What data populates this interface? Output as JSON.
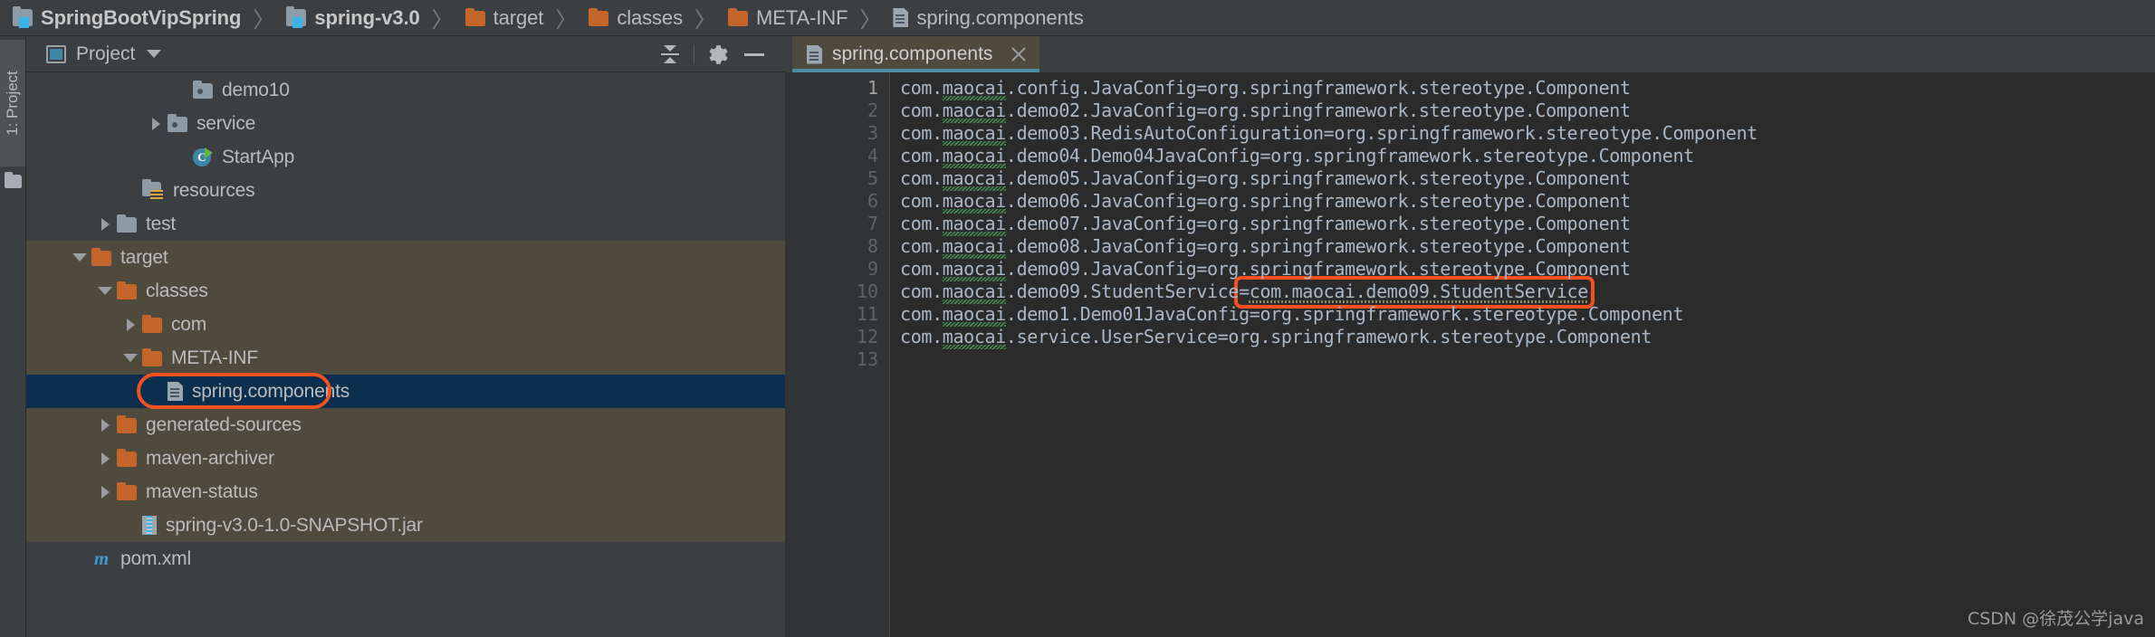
{
  "breadcrumb": {
    "items": [
      {
        "label": "SpringBootVipSpring",
        "icon": "module-icon",
        "bold": true
      },
      {
        "label": "spring-v3.0",
        "icon": "module-icon",
        "bold": true
      },
      {
        "label": "target",
        "icon": "folder-orange-icon",
        "bold": false
      },
      {
        "label": "classes",
        "icon": "folder-orange-icon",
        "bold": false
      },
      {
        "label": "META-INF",
        "icon": "folder-orange-icon",
        "bold": false
      },
      {
        "label": "spring.components",
        "icon": "file-icon",
        "bold": false
      }
    ],
    "separator": "〉"
  },
  "tool_strip": {
    "project_button_label": "1: Project",
    "folder_icon": "folder-icon"
  },
  "project_panel": {
    "title": "Project",
    "window_icon": "project-window-icon",
    "dropdown_icon": "chevron-down-icon",
    "toolbar": [
      {
        "name": "collapse-all-icon",
        "label": "Collapse All"
      },
      {
        "name": "gear-icon",
        "label": "Settings"
      },
      {
        "name": "minimize-icon",
        "label": "Hide"
      }
    ],
    "tree": [
      {
        "label": "demo10",
        "indent": 5,
        "twisty": "none",
        "icon": "folder-pkg-icon",
        "state": "normal"
      },
      {
        "label": "service",
        "indent": 4,
        "twisty": "collapsed",
        "icon": "folder-pkg-icon",
        "state": "normal"
      },
      {
        "label": "StartApp",
        "indent": 5,
        "twisty": "none",
        "icon": "class-run-icon",
        "state": "normal"
      },
      {
        "label": "resources",
        "indent": 3,
        "twisty": "none",
        "icon": "folder-resource-icon",
        "state": "normal"
      },
      {
        "label": "test",
        "indent": 2,
        "twisty": "collapsed",
        "icon": "folder-grey-icon",
        "state": "normal"
      },
      {
        "label": "target",
        "indent": 1,
        "twisty": "open",
        "icon": "folder-orange-icon",
        "state": "excluded"
      },
      {
        "label": "classes",
        "indent": 2,
        "twisty": "open",
        "icon": "folder-orange-icon",
        "state": "excluded"
      },
      {
        "label": "com",
        "indent": 3,
        "twisty": "collapsed",
        "icon": "folder-orange-icon",
        "state": "excluded"
      },
      {
        "label": "META-INF",
        "indent": 3,
        "twisty": "open",
        "icon": "folder-orange-icon",
        "state": "excluded"
      },
      {
        "label": "spring.components",
        "indent": 4,
        "twisty": "none",
        "icon": "file-icon",
        "state": "selected"
      },
      {
        "label": "generated-sources",
        "indent": 2,
        "twisty": "collapsed",
        "icon": "folder-orange-icon",
        "state": "excluded"
      },
      {
        "label": "maven-archiver",
        "indent": 2,
        "twisty": "collapsed",
        "icon": "folder-orange-icon",
        "state": "excluded"
      },
      {
        "label": "maven-status",
        "indent": 2,
        "twisty": "collapsed",
        "icon": "folder-orange-icon",
        "state": "excluded"
      },
      {
        "label": "spring-v3.0-1.0-SNAPSHOT.jar",
        "indent": 3,
        "twisty": "none",
        "icon": "jar-icon",
        "state": "excluded"
      },
      {
        "label": "pom.xml",
        "indent": 1,
        "twisty": "none",
        "icon": "maven-icon",
        "state": "normal"
      }
    ]
  },
  "editor": {
    "tab": {
      "label": "spring.components",
      "icon": "file-icon",
      "close_icon": "close-icon"
    },
    "line_numbers": [
      "1",
      "2",
      "3",
      "4",
      "5",
      "6",
      "7",
      "8",
      "9",
      "10",
      "11",
      "12",
      "13"
    ],
    "current_line": 1,
    "lines": [
      "com.maocai.config.JavaConfig=org.springframework.stereotype.Component",
      "com.maocai.demo02.JavaConfig=org.springframework.stereotype.Component",
      "com.maocai.demo03.RedisAutoConfiguration=org.springframework.stereotype.Component",
      "com.maocai.demo04.Demo04JavaConfig=org.springframework.stereotype.Component",
      "com.maocai.demo05.JavaConfig=org.springframework.stereotype.Component",
      "com.maocai.demo06.JavaConfig=org.springframework.stereotype.Component",
      "com.maocai.demo07.JavaConfig=org.springframework.stereotype.Component",
      "com.maocai.demo08.JavaConfig=org.springframework.stereotype.Component",
      "com.maocai.demo09.JavaConfig=org.springframework.stereotype.Component",
      "com.maocai.demo09.StudentService=com.maocai.demo09.StudentService",
      "com.maocai.demo1.Demo01JavaConfig=org.springframework.stereotype.Component",
      "com.maocai.service.UserService=org.springframework.stereotype.Component",
      ""
    ]
  },
  "annotations": {
    "color": "#f4511e",
    "tree_target": "spring.components",
    "code_target": "=com.maocai.demo09.StudentService"
  },
  "watermark": {
    "text": "CSDN @徐茂公学java"
  }
}
